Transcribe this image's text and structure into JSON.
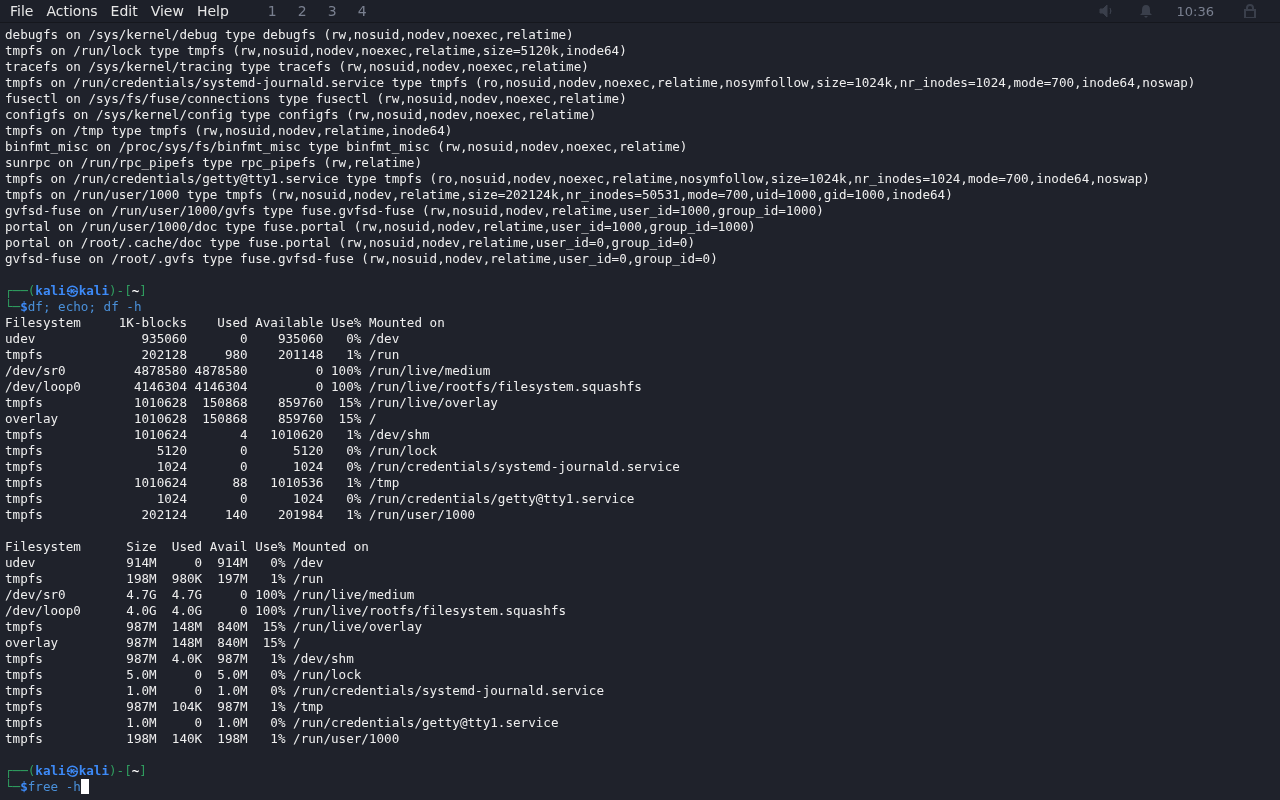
{
  "menu": [
    "File",
    "Actions",
    "Edit",
    "View",
    "Help"
  ],
  "panel": {
    "workspaces": [
      "1",
      "2",
      "3",
      "4"
    ],
    "clock": "10:36"
  },
  "lines": [
    {
      "kind": "text",
      "text": "debugfs on /sys/kernel/debug type debugfs (rw,nosuid,nodev,noexec,relatime)"
    },
    {
      "kind": "text",
      "text": "tmpfs on /run/lock type tmpfs (rw,nosuid,nodev,noexec,relatime,size=5120k,inode64)"
    },
    {
      "kind": "text",
      "text": "tracefs on /sys/kernel/tracing type tracefs (rw,nosuid,nodev,noexec,relatime)"
    },
    {
      "kind": "text",
      "text": "tmpfs on /run/credentials/systemd-journald.service type tmpfs (ro,nosuid,nodev,noexec,relatime,nosymfollow,size=1024k,nr_inodes=1024,mode=700,inode64,noswap)"
    },
    {
      "kind": "text",
      "text": "fusectl on /sys/fs/fuse/connections type fusectl (rw,nosuid,nodev,noexec,relatime)"
    },
    {
      "kind": "text",
      "text": "configfs on /sys/kernel/config type configfs (rw,nosuid,nodev,noexec,relatime)"
    },
    {
      "kind": "text",
      "text": "tmpfs on /tmp type tmpfs (rw,nosuid,nodev,relatime,inode64)"
    },
    {
      "kind": "text",
      "text": "binfmt_misc on /proc/sys/fs/binfmt_misc type binfmt_misc (rw,nosuid,nodev,noexec,relatime)"
    },
    {
      "kind": "text",
      "text": "sunrpc on /run/rpc_pipefs type rpc_pipefs (rw,relatime)"
    },
    {
      "kind": "text",
      "text": "tmpfs on /run/credentials/getty@tty1.service type tmpfs (ro,nosuid,nodev,noexec,relatime,nosymfollow,size=1024k,nr_inodes=1024,mode=700,inode64,noswap)"
    },
    {
      "kind": "text",
      "text": "tmpfs on /run/user/1000 type tmpfs (rw,nosuid,nodev,relatime,size=202124k,nr_inodes=50531,mode=700,uid=1000,gid=1000,inode64)"
    },
    {
      "kind": "text",
      "text": "gvfsd-fuse on /run/user/1000/gvfs type fuse.gvfsd-fuse (rw,nosuid,nodev,relatime,user_id=1000,group_id=1000)"
    },
    {
      "kind": "text",
      "text": "portal on /run/user/1000/doc type fuse.portal (rw,nosuid,nodev,relatime,user_id=1000,group_id=1000)"
    },
    {
      "kind": "text",
      "text": "portal on /root/.cache/doc type fuse.portal (rw,nosuid,nodev,relatime,user_id=0,group_id=0)"
    },
    {
      "kind": "text",
      "text": "gvfsd-fuse on /root/.gvfs type fuse.gvfsd-fuse (rw,nosuid,nodev,relatime,user_id=0,group_id=0)"
    },
    {
      "kind": "blank"
    },
    {
      "kind": "prompt",
      "open": "┌──(",
      "user": "kali",
      "at": "㉿",
      "host": "kali",
      "mid": ")-[",
      "dir": "~",
      "close": "]",
      "corner": "└─",
      "symbol": "$",
      "command": "df; echo; df -h",
      "cursor": false
    },
    {
      "kind": "text",
      "text": "Filesystem     1K-blocks    Used Available Use% Mounted on"
    },
    {
      "kind": "text",
      "text": "udev              935060       0    935060   0% /dev"
    },
    {
      "kind": "text",
      "text": "tmpfs             202128     980    201148   1% /run"
    },
    {
      "kind": "text",
      "text": "/dev/sr0         4878580 4878580         0 100% /run/live/medium"
    },
    {
      "kind": "text",
      "text": "/dev/loop0       4146304 4146304         0 100% /run/live/rootfs/filesystem.squashfs"
    },
    {
      "kind": "text",
      "text": "tmpfs            1010628  150868    859760  15% /run/live/overlay"
    },
    {
      "kind": "text",
      "text": "overlay          1010628  150868    859760  15% /"
    },
    {
      "kind": "text",
      "text": "tmpfs            1010624       4   1010620   1% /dev/shm"
    },
    {
      "kind": "text",
      "text": "tmpfs               5120       0      5120   0% /run/lock"
    },
    {
      "kind": "text",
      "text": "tmpfs               1024       0      1024   0% /run/credentials/systemd-journald.service"
    },
    {
      "kind": "text",
      "text": "tmpfs            1010624      88   1010536   1% /tmp"
    },
    {
      "kind": "text",
      "text": "tmpfs               1024       0      1024   0% /run/credentials/getty@tty1.service"
    },
    {
      "kind": "text",
      "text": "tmpfs             202124     140    201984   1% /run/user/1000"
    },
    {
      "kind": "blank"
    },
    {
      "kind": "text",
      "text": "Filesystem      Size  Used Avail Use% Mounted on"
    },
    {
      "kind": "text",
      "text": "udev            914M     0  914M   0% /dev"
    },
    {
      "kind": "text",
      "text": "tmpfs           198M  980K  197M   1% /run"
    },
    {
      "kind": "text",
      "text": "/dev/sr0        4.7G  4.7G     0 100% /run/live/medium"
    },
    {
      "kind": "text",
      "text": "/dev/loop0      4.0G  4.0G     0 100% /run/live/rootfs/filesystem.squashfs"
    },
    {
      "kind": "text",
      "text": "tmpfs           987M  148M  840M  15% /run/live/overlay"
    },
    {
      "kind": "text",
      "text": "overlay         987M  148M  840M  15% /"
    },
    {
      "kind": "text",
      "text": "tmpfs           987M  4.0K  987M   1% /dev/shm"
    },
    {
      "kind": "text",
      "text": "tmpfs           5.0M     0  5.0M   0% /run/lock"
    },
    {
      "kind": "text",
      "text": "tmpfs           1.0M     0  1.0M   0% /run/credentials/systemd-journald.service"
    },
    {
      "kind": "text",
      "text": "tmpfs           987M  104K  987M   1% /tmp"
    },
    {
      "kind": "text",
      "text": "tmpfs           1.0M     0  1.0M   0% /run/credentials/getty@tty1.service"
    },
    {
      "kind": "text",
      "text": "tmpfs           198M  140K  198M   1% /run/user/1000"
    },
    {
      "kind": "blank"
    },
    {
      "kind": "prompt",
      "open": "┌──(",
      "user": "kali",
      "at": "㉿",
      "host": "kali",
      "mid": ")-[",
      "dir": "~",
      "close": "]",
      "corner": "└─",
      "symbol": "$",
      "command": "free -h",
      "cursor": true
    }
  ]
}
